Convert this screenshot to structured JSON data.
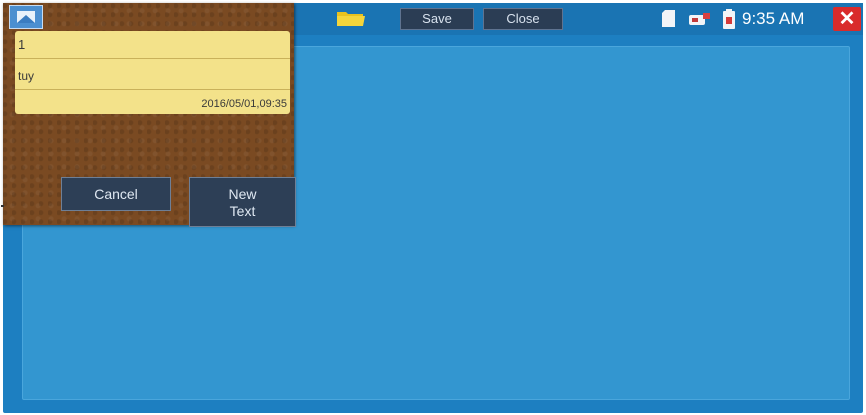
{
  "toolbar": {
    "save_label": "Save",
    "close_label": "Close",
    "icons": [
      "folder-icon",
      "sd-card-icon",
      "usb-icon",
      "battery-icon",
      "close-x-icon"
    ]
  },
  "status": {
    "time": "9:35 AM"
  },
  "memo": {
    "line1": "1",
    "line2": "tuy",
    "line3": "2016/05/01,09:35"
  },
  "dialog": {
    "cancel_label": "Cancel",
    "new_text_label_line1": "New",
    "new_text_label_line2": "Text"
  },
  "colors": {
    "screen_bg": "#1d7fc1",
    "content_bg": "#3396d0",
    "dialog_bg": "#7a4a22",
    "memo_bg": "#f3e28a",
    "button_bg": "#2d3f56",
    "close_red": "#d92b2b"
  }
}
